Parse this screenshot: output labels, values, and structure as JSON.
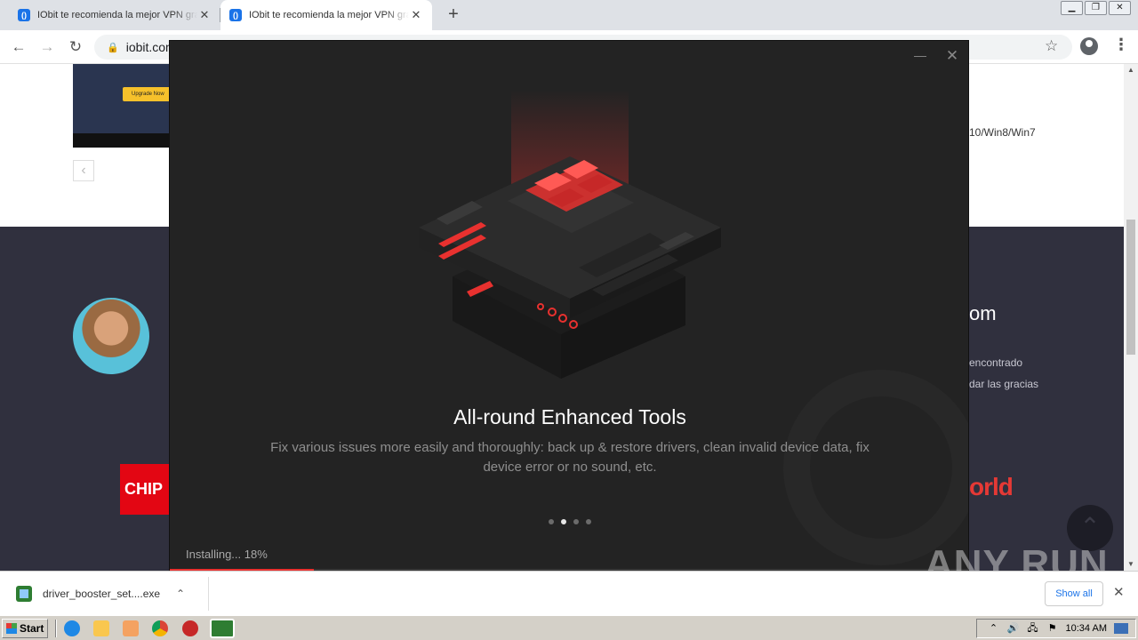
{
  "browser": {
    "tabs": [
      {
        "title": "IObit te recomienda la mejor VPN gratis",
        "close": "✕"
      },
      {
        "title": "IObit te recomienda la mejor VPN gratis",
        "close": "✕"
      }
    ],
    "new_tab": "+",
    "window_controls": {
      "minimize": "▁",
      "restore": "❐",
      "close": "✕"
    },
    "nav": {
      "back": "←",
      "forward": "→",
      "reload": "↻"
    },
    "address": "iobit.com",
    "lock": "🔒",
    "bookmark_star": "☆",
    "menu": "⋮"
  },
  "webpage": {
    "upgrade_button": "Upgrade Now",
    "prev": "‹",
    "os_label": "10/Win8/Win7",
    "review_title": "om",
    "review_line1": "encontrado",
    "review_line2": "dar las gracias",
    "chip_logo": "CHIP",
    "world_logo": "orld",
    "scroll_top": "⌃"
  },
  "scrollbar": {
    "up": "▲",
    "down": "▼"
  },
  "installer": {
    "minimize": "—",
    "close": "✕",
    "slide_title": "All-round Enhanced Tools",
    "slide_description": "Fix various issues more easily and thoroughly: back up & restore drivers, clean invalid device data, fix device error or no sound, etc.",
    "dots_total": 4,
    "active_dot": 1,
    "status": "Installing... 18%",
    "progress_percent": 18,
    "accent_color": "#e8312f"
  },
  "watermark": "ANY RUN",
  "download_bar": {
    "file_name": "driver_booster_set....exe",
    "chevron": "⌃",
    "show_all": "Show all",
    "close": "✕"
  },
  "taskbar": {
    "start": "Start",
    "clock": "10:34 AM",
    "tray_icons": [
      "⌃",
      "🔊",
      "🖧",
      "⚑"
    ]
  }
}
